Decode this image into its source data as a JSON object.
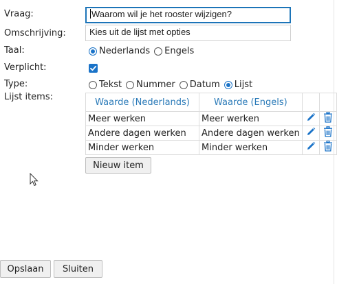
{
  "form": {
    "vraag": {
      "label": "Vraag:",
      "value": "Waarom wil je het rooster wijzigen?"
    },
    "omschrijving": {
      "label": "Omschrijving:",
      "value": "Kies uit de lijst met opties"
    },
    "taal": {
      "label": "Taal:",
      "options": [
        "Nederlands",
        "Engels"
      ],
      "selected": "Nederlands"
    },
    "verplicht": {
      "label": "Verplicht:",
      "checked": true
    },
    "type": {
      "label": "Type:",
      "options": [
        "Tekst",
        "Nummer",
        "Datum",
        "Lijst"
      ],
      "selected": "Lijst"
    },
    "lijst_items": {
      "label": "Lijst items:",
      "columns": [
        "Waarde (Nederlands)",
        "Waarde (Engels)"
      ],
      "rows": [
        {
          "nl": "Meer werken",
          "en": "Meer werken"
        },
        {
          "nl": "Andere dagen werken",
          "en": "Andere dagen werken"
        },
        {
          "nl": "Minder werken",
          "en": "Minder werken"
        }
      ],
      "new_item_label": "Nieuw item"
    }
  },
  "footer": {
    "save_label": "Opslaan",
    "close_label": "Sluiten"
  },
  "colors": {
    "accent": "#1a73c8",
    "header_text": "#2a7ab8",
    "focus_border": "#1c74b8"
  },
  "icons": {
    "edit": "pencil-icon",
    "delete": "trash-icon"
  }
}
